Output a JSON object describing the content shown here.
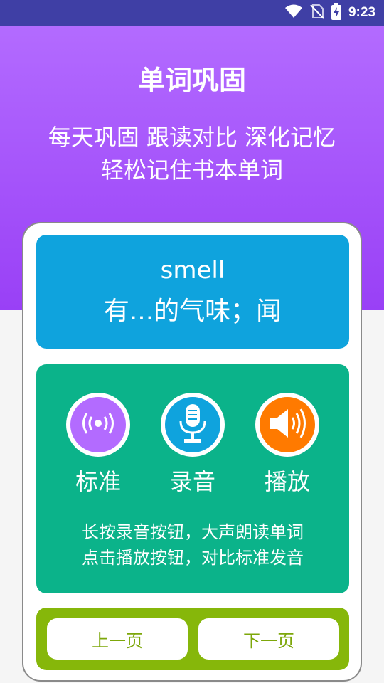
{
  "status_bar": {
    "time": "9:23"
  },
  "header": {
    "title": "单词巩固",
    "subtitle_line1": "每天巩固 跟读对比 深化记忆",
    "subtitle_line2": "轻松记住书本单词"
  },
  "word": {
    "text": "smell",
    "meaning": "有...的气味；闻"
  },
  "controls": [
    {
      "label": "标准",
      "icon": "broadcast-icon",
      "color": "#b36bff"
    },
    {
      "label": "录音",
      "icon": "microphone-icon",
      "color": "#0fa3dd"
    },
    {
      "label": "播放",
      "icon": "speaker-icon",
      "color": "#ff7a00"
    }
  ],
  "hints": {
    "line1": "长按录音按钮，大声朗读单词",
    "line2": "点击播放按钮，对比标准发音"
  },
  "nav": {
    "prev_label": "上一页",
    "next_label": "下一页"
  },
  "colors": {
    "header_purple": "#9940f6",
    "word_panel_blue": "#0fa3dd",
    "practice_panel_green": "#0bb38a",
    "nav_panel_green": "#86b70a",
    "status_bar": "#3f3fa5"
  }
}
